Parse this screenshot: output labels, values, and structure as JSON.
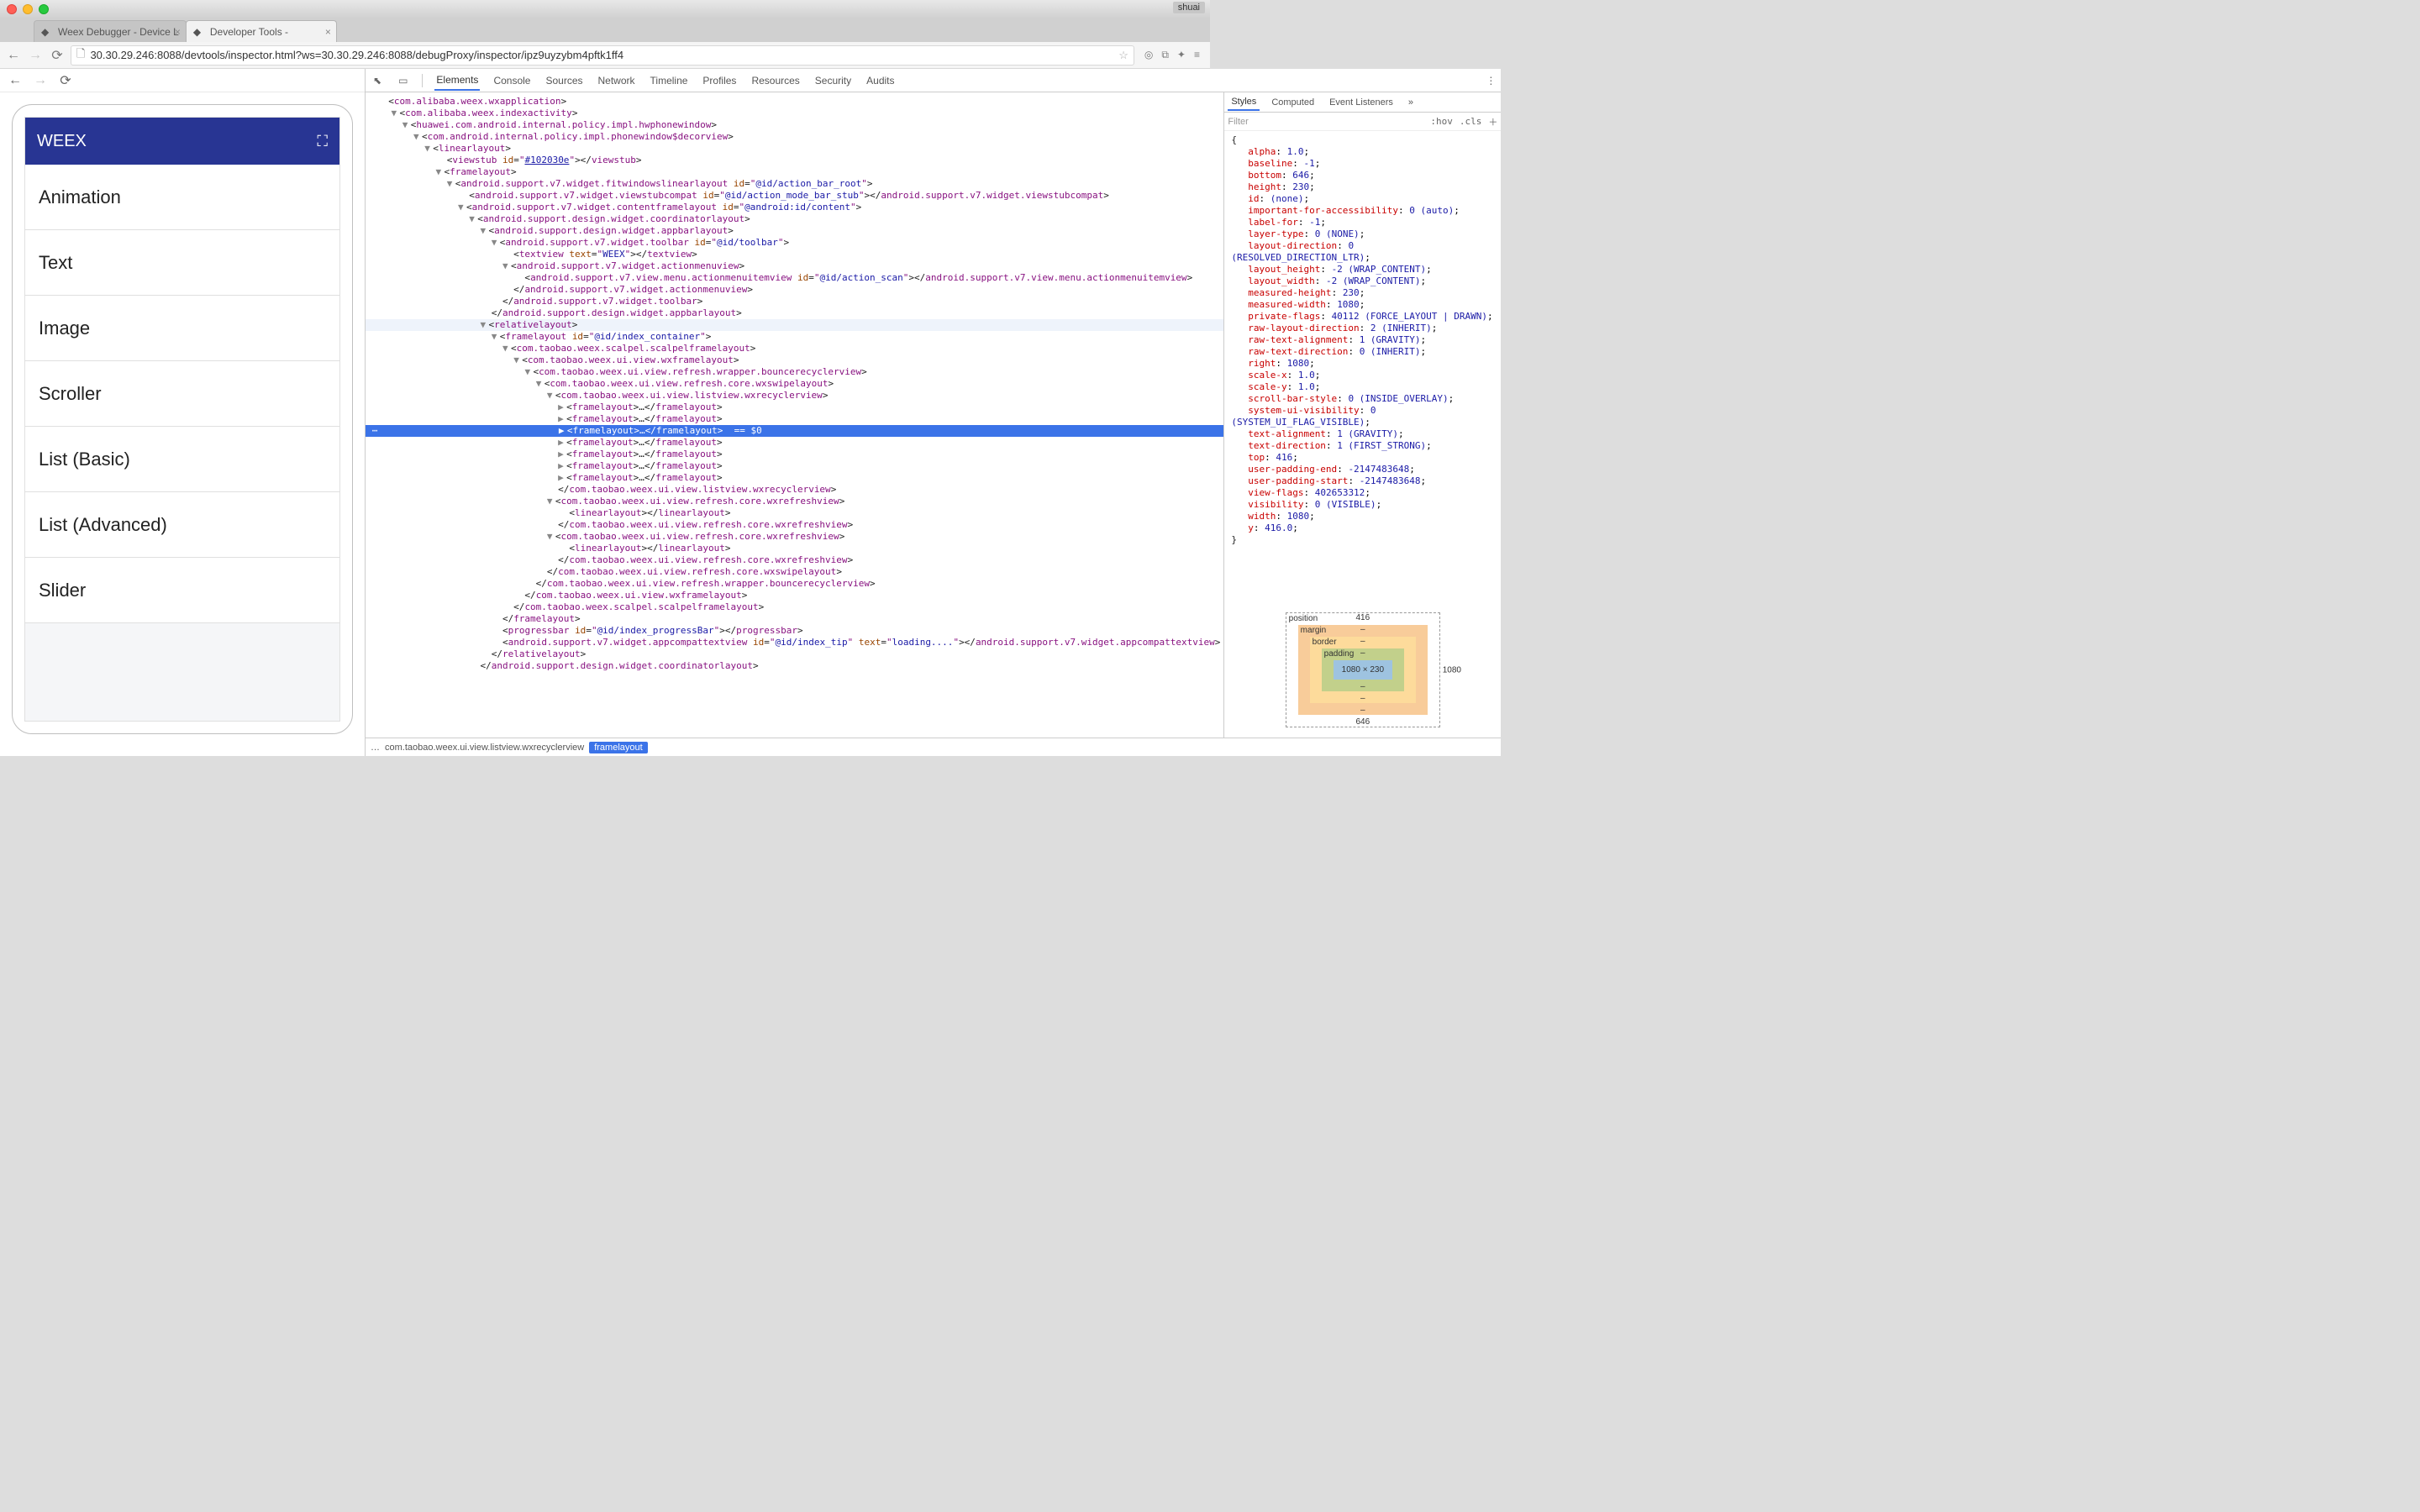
{
  "titlebar": {
    "user": "shuai"
  },
  "browser_tabs": [
    {
      "title": "Weex Debugger - Device L",
      "active": false
    },
    {
      "title": "Developer Tools -",
      "active": true
    }
  ],
  "url": "30.30.29.246:8088/devtools/inspector.html?ws=30.30.29.246:8088/debugProxy/inspector/ipz9uyzybm4pftk1ff4",
  "devtools_tabs": [
    "Elements",
    "Console",
    "Sources",
    "Network",
    "Timeline",
    "Profiles",
    "Resources",
    "Security",
    "Audits"
  ],
  "devtools_active_tab": "Elements",
  "preview": {
    "header_title": "WEEX",
    "items": [
      "Animation",
      "Text",
      "Image",
      "Scroller",
      "List (Basic)",
      "List (Advanced)",
      "Slider"
    ]
  },
  "styles_tabs": [
    "Styles",
    "Computed",
    "Event Listeners"
  ],
  "styles_active": "Styles",
  "styles_filter_placeholder": "Filter",
  "styles_tools": {
    "hov": ":hov",
    "cls": ".cls"
  },
  "styles_props": [
    [
      "alpha",
      "1.0"
    ],
    [
      "baseline",
      "-1"
    ],
    [
      "bottom",
      "646"
    ],
    [
      "height",
      "230"
    ],
    [
      "id",
      "(none)"
    ],
    [
      "important-for-accessibility",
      "0 (auto)"
    ],
    [
      "label-for",
      "-1"
    ],
    [
      "layer-type",
      "0 (NONE)"
    ],
    [
      "layout-direction",
      "0 (RESOLVED_DIRECTION_LTR)"
    ],
    [
      "layout_height",
      "-2 (WRAP_CONTENT)"
    ],
    [
      "layout_width",
      "-2 (WRAP_CONTENT)"
    ],
    [
      "measured-height",
      "230"
    ],
    [
      "measured-width",
      "1080"
    ],
    [
      "private-flags",
      "40112 (FORCE_LAYOUT | DRAWN)"
    ],
    [
      "raw-layout-direction",
      "2 (INHERIT)"
    ],
    [
      "raw-text-alignment",
      "1 (GRAVITY)"
    ],
    [
      "raw-text-direction",
      "0 (INHERIT)"
    ],
    [
      "right",
      "1080"
    ],
    [
      "scale-x",
      "1.0"
    ],
    [
      "scale-y",
      "1.0"
    ],
    [
      "scroll-bar-style",
      "0 (INSIDE_OVERLAY)"
    ],
    [
      "system-ui-visibility",
      "0 (SYSTEM_UI_FLAG_VISIBLE)"
    ],
    [
      "text-alignment",
      "1 (GRAVITY)"
    ],
    [
      "text-direction",
      "1 (FIRST_STRONG)"
    ],
    [
      "top",
      "416"
    ],
    [
      "user-padding-end",
      "-2147483648"
    ],
    [
      "user-padding-start",
      "-2147483648"
    ],
    [
      "view-flags",
      "402653312"
    ],
    [
      "visibility",
      "0 (VISIBLE)"
    ],
    [
      "width",
      "1080"
    ],
    [
      "y",
      "416.0"
    ]
  ],
  "box_model": {
    "pos_label": "position",
    "pos_top": "416",
    "pos_right": "1080",
    "pos_bottom": "646",
    "margin_label": "margin",
    "border_label": "border",
    "padding_label": "padding",
    "content": "1080 × 230",
    "dash": "–"
  },
  "breadcrumb": {
    "ellipsis": "…",
    "parent": "com.taobao.weex.ui.view.listview.wxrecyclerview",
    "current": "framelayout"
  },
  "selected_suffix": "== $0",
  "el": {
    "app": "com.alibaba.weex.wxapplication",
    "index": "com.alibaba.weex.indexactivity",
    "hw": "huawei.com.android.internal.policy.impl.hwphonewindow",
    "decor": "com.android.internal.policy.impl.phonewindow$decorview",
    "ll": "linearlayout",
    "vs": "viewstub",
    "vs_id": "#102030e",
    "fl": "framelayout",
    "fit": "android.support.v7.widget.fitwindowslinearlayout",
    "fit_id": "@id/action_bar_root",
    "vsc": "android.support.v7.widget.viewstubcompat",
    "vsc_id": "@id/action_mode_bar_stub",
    "cfl": "android.support.v7.widget.contentframelayout",
    "cfl_id": "@android:id/content",
    "coord": "android.support.design.widget.coordinatorlayout",
    "appbar": "android.support.design.widget.appbarlayout",
    "toolbar": "android.support.v7.widget.toolbar",
    "toolbar_id": "@id/toolbar",
    "tv": "textview",
    "tv_attr": "text",
    "tv_val": "WEEX",
    "amv": "android.support.v7.widget.actionmenuview",
    "amiv": "android.support.v7.view.menu.actionmenuitemview",
    "amiv_id": "@id/action_scan",
    "rel": "relativelayout",
    "fl_idx": "@id/index_container",
    "scalpel": "com.taobao.weex.scalpel.scalpelframelayout",
    "wxfl": "com.taobao.weex.ui.view.wxframelayout",
    "bouncerec": "com.taobao.weex.ui.view.refresh.wrapper.bouncerecyclerview",
    "swipe": "com.taobao.weex.ui.view.refresh.core.wxswipelayout",
    "recycler": "com.taobao.weex.ui.view.listview.wxrecyclerview",
    "refreshview": "com.taobao.weex.ui.view.refresh.core.wxrefreshview",
    "prog": "progressbar",
    "prog_id": "@id/index_progressBar",
    "tip": "android.support.v7.widget.appcompattextview",
    "tip_id": "@id/index_tip",
    "tip_text": "loading...."
  }
}
